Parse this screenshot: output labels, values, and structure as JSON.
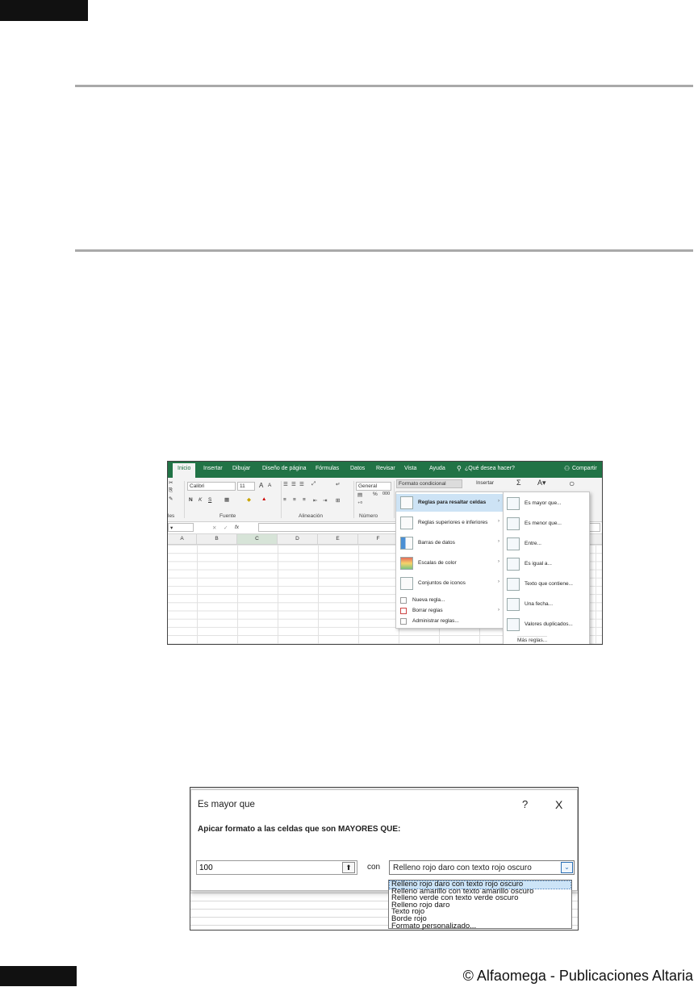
{
  "tabs": [
    "Inicio",
    "Insertar",
    "Dibujar",
    "Diseño de página",
    "Fórmulas",
    "Datos",
    "Revisar",
    "Vista",
    "Ayuda"
  ],
  "search_icon": "lightbulb-search-icon",
  "search_label": "¿Qué desea hacer?",
  "share_label": "Compartir",
  "ribbon": {
    "font_name": "Calibri",
    "font_size": "11",
    "grow_font": "A",
    "shrink_font": "A",
    "bold": "N",
    "italic": "K",
    "underline": "S",
    "number_format": "General",
    "percent": "%",
    "thousands": "000",
    "cond_format": "Formato condicional",
    "insert": "Insertar",
    "sum": "Σ",
    "group_clipboard": "les",
    "group_font": "Fuente",
    "group_alignment": "Alineación",
    "group_number": "Número"
  },
  "formula_bar": {
    "fx": "fx"
  },
  "columns": [
    "A",
    "B",
    "C",
    "D",
    "E",
    "F"
  ],
  "cf_menu": [
    {
      "label": "Reglas para resaltar celdas",
      "arrow": "›"
    },
    {
      "label": "Reglas superiores e inferiores",
      "arrow": "›"
    },
    {
      "label": "Barras de datos",
      "arrow": "›"
    },
    {
      "label": "Escalas de color",
      "arrow": "›"
    },
    {
      "label": "Conjuntos de iconos",
      "arrow": "›"
    }
  ],
  "cf_menu_small": [
    {
      "label": "Nueva regla...",
      "arrow": ""
    },
    {
      "label": "Borrar reglas",
      "arrow": "›"
    },
    {
      "label": "Administrar reglas...",
      "arrow": ""
    }
  ],
  "highlight_submenu": [
    "Es mayor que...",
    "Es menor que...",
    "Entre...",
    "Es igual a...",
    "Texto que contiene...",
    "Una fecha...",
    "Valores duplicados..."
  ],
  "more_rules": "Más reglas...",
  "dialog": {
    "title": "Es mayor que",
    "help": "?",
    "close": "X",
    "instruction": "Apicar formato a las celdas que son MAYORES QUE:",
    "value": "100",
    "collapse_glyph": "⬆",
    "con_label": "con",
    "selected_format": "Relleno rojo daro con texto rojo oscuro",
    "dropdown_glyph": "⌄",
    "options": [
      "Relleno rojo daro con texto rojo oscuro",
      "Relleno amarillo con texto amarillo oscuro",
      "Relleno verde con texto verde oscuro",
      "Relleno rojo daro",
      "Texto rojo",
      "Borde rojo",
      "Formato personalizado..."
    ]
  },
  "footer": "© Alfaomega - Publicaciones Altaria",
  "colors": {
    "excel_green": "#217346",
    "rule_gray": "#a9a9a9",
    "highlight": "#cde3f5"
  }
}
